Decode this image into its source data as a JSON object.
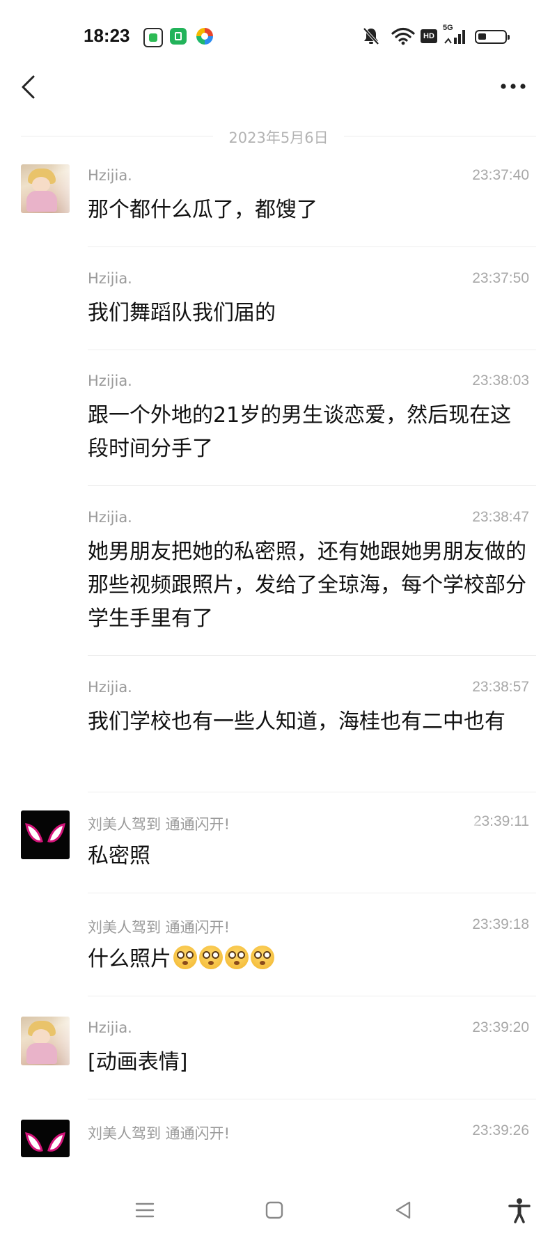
{
  "status_bar": {
    "time": "18:23",
    "network": "5G",
    "hd_label": "HD",
    "battery_level": 0.3,
    "icons": [
      "app-icon-1",
      "app-icon-2",
      "app-icon-3",
      "bell-muted-icon",
      "wifi-icon",
      "signal-icon",
      "battery-icon"
    ]
  },
  "header": {
    "back_icon": "chevron-left-icon",
    "more_icon": "more-horizontal-icon"
  },
  "date_separator": "2023年5月6日",
  "messages": [
    {
      "sender": "Hzijia.",
      "time": "23:37:40",
      "text": "那个都什么瓜了，都馊了",
      "avatar": "girl"
    },
    {
      "sender": "Hzijia.",
      "time": "23:37:50",
      "text": "我们舞蹈队我们届的"
    },
    {
      "sender": "Hzijia.",
      "time": "23:38:03",
      "text": "跟一个外地的21岁的男生谈恋爱，然后现在这段时间分手了"
    },
    {
      "sender": "Hzijia.",
      "time": "23:38:47",
      "text": "她男朋友把她的私密照，还有她跟她男朋友做的那些视频跟照片，发给了全琼海，每个学校部分学生手里有了"
    },
    {
      "sender": "Hzijia.",
      "time": "23:38:57",
      "text": "我们学校也有一些人知道，海桂也有二中也有"
    },
    {
      "sender": "刘美人驾到 通通闪开!",
      "time": "23:39:11",
      "text": "私密照",
      "avatar": "spider"
    },
    {
      "sender": "刘美人驾到 通通闪开!",
      "time": "23:39:18",
      "text": "什么照片",
      "emoji_count": 4
    },
    {
      "sender": "Hzijia.",
      "time": "23:39:20",
      "text": "[动画表情]",
      "avatar": "girl"
    },
    {
      "sender": "刘美人驾到 通通闪开!",
      "time": "23:39:26",
      "avatar": "spider"
    }
  ],
  "nav_bar": {
    "icons": [
      "menu-icon",
      "home-square-icon",
      "back-triangle-icon",
      "accessibility-icon"
    ]
  },
  "colors": {
    "background": "#ffffff",
    "text": "#111111",
    "meta_text": "#9a9a9a",
    "divider": "#ededed"
  }
}
